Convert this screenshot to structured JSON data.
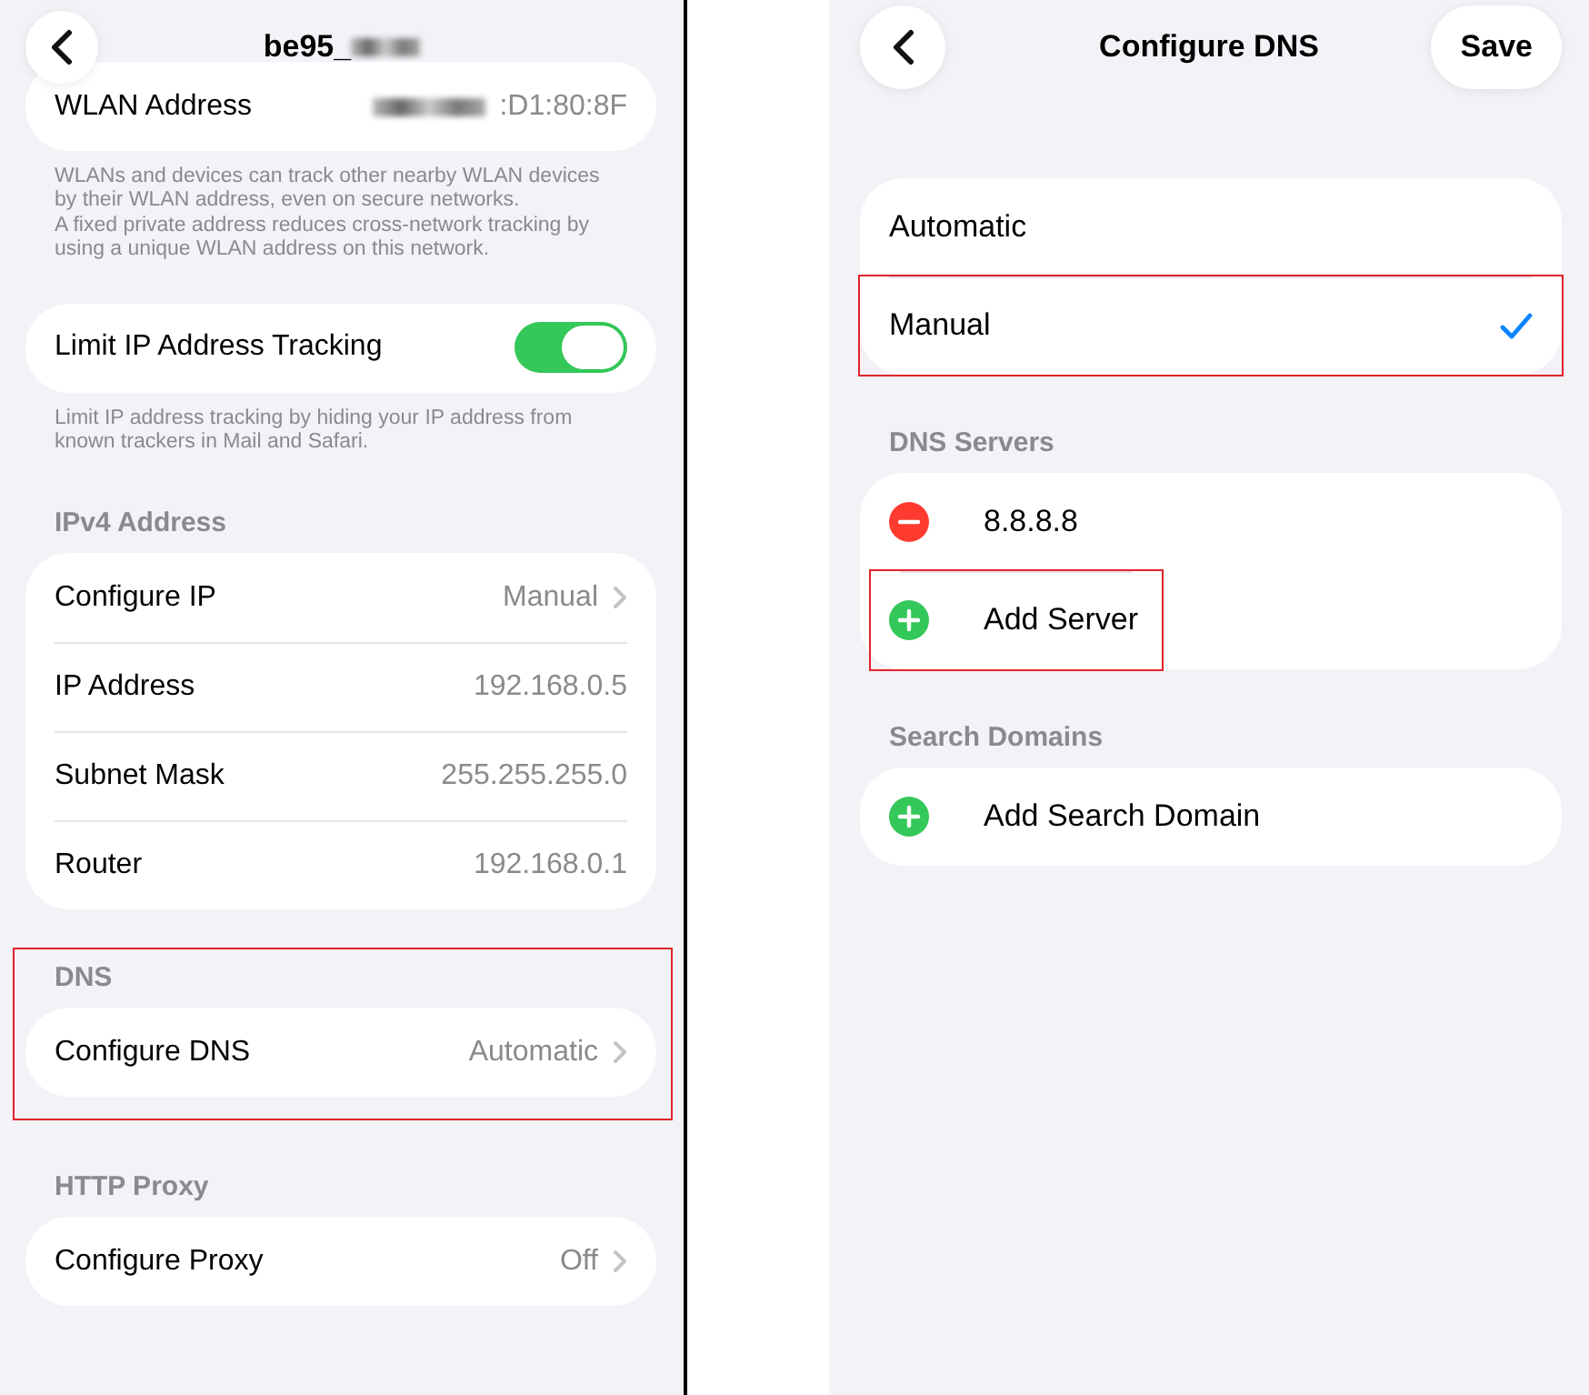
{
  "left": {
    "title": "be95_",
    "title_redacted": true,
    "sections": [
      {
        "highlighted": false,
        "rows": [
          {
            "kind": "value",
            "label": "WLAN Address",
            "value": ":D1:80:8F",
            "redacted": true,
            "highlighted": false
          }
        ],
        "notes": [
          "WLANs and devices can track other nearby WLAN devices by their WLAN address, even on secure networks.",
          "A fixed private address reduces cross-network tracking by using a unique WLAN address on this network."
        ]
      },
      {
        "highlighted": false,
        "rows": [
          {
            "kind": "toggle",
            "label": "Limit IP Address Tracking",
            "on": true,
            "highlighted": false
          }
        ],
        "notes": [
          "Limit IP address tracking by hiding your IP address from known trackers in Mail and Safari."
        ]
      },
      {
        "highlighted": false,
        "header": "IPv4 Address",
        "rows": [
          {
            "kind": "nav",
            "label": "Configure IP",
            "value": "Manual",
            "highlighted": false
          },
          {
            "kind": "value",
            "label": "IP Address",
            "value": "192.168.0.5",
            "highlighted": false
          },
          {
            "kind": "value",
            "label": "Subnet Mask",
            "value": "255.255.255.0",
            "highlighted": false
          },
          {
            "kind": "value",
            "label": "Router",
            "value": "192.168.0.1",
            "highlighted": false
          }
        ]
      },
      {
        "highlighted": true,
        "header": "DNS",
        "rows": [
          {
            "kind": "nav",
            "label": "Configure DNS",
            "value": "Automatic",
            "highlighted": false
          }
        ]
      },
      {
        "highlighted": false,
        "header": "HTTP Proxy",
        "rows": [
          {
            "kind": "nav",
            "label": "Configure Proxy",
            "value": "Off",
            "highlighted": false
          }
        ]
      }
    ]
  },
  "right": {
    "title": "Configure DNS",
    "save": "Save",
    "sections": [
      {
        "highlighted": false,
        "rows": [
          {
            "kind": "option",
            "label": "Automatic",
            "selected": false,
            "highlighted": false
          },
          {
            "kind": "option",
            "label": "Manual",
            "selected": true,
            "highlighted": true
          }
        ]
      },
      {
        "highlighted": false,
        "header": "DNS Servers",
        "rows": [
          {
            "kind": "remove",
            "label": "8.8.8.8",
            "highlighted": false
          },
          {
            "kind": "add",
            "label": "Add Server",
            "highlighted": true
          }
        ]
      },
      {
        "highlighted": false,
        "header": "Search Domains",
        "rows": [
          {
            "kind": "add",
            "label": "Add Search Domain",
            "highlighted": false
          }
        ]
      }
    ]
  }
}
